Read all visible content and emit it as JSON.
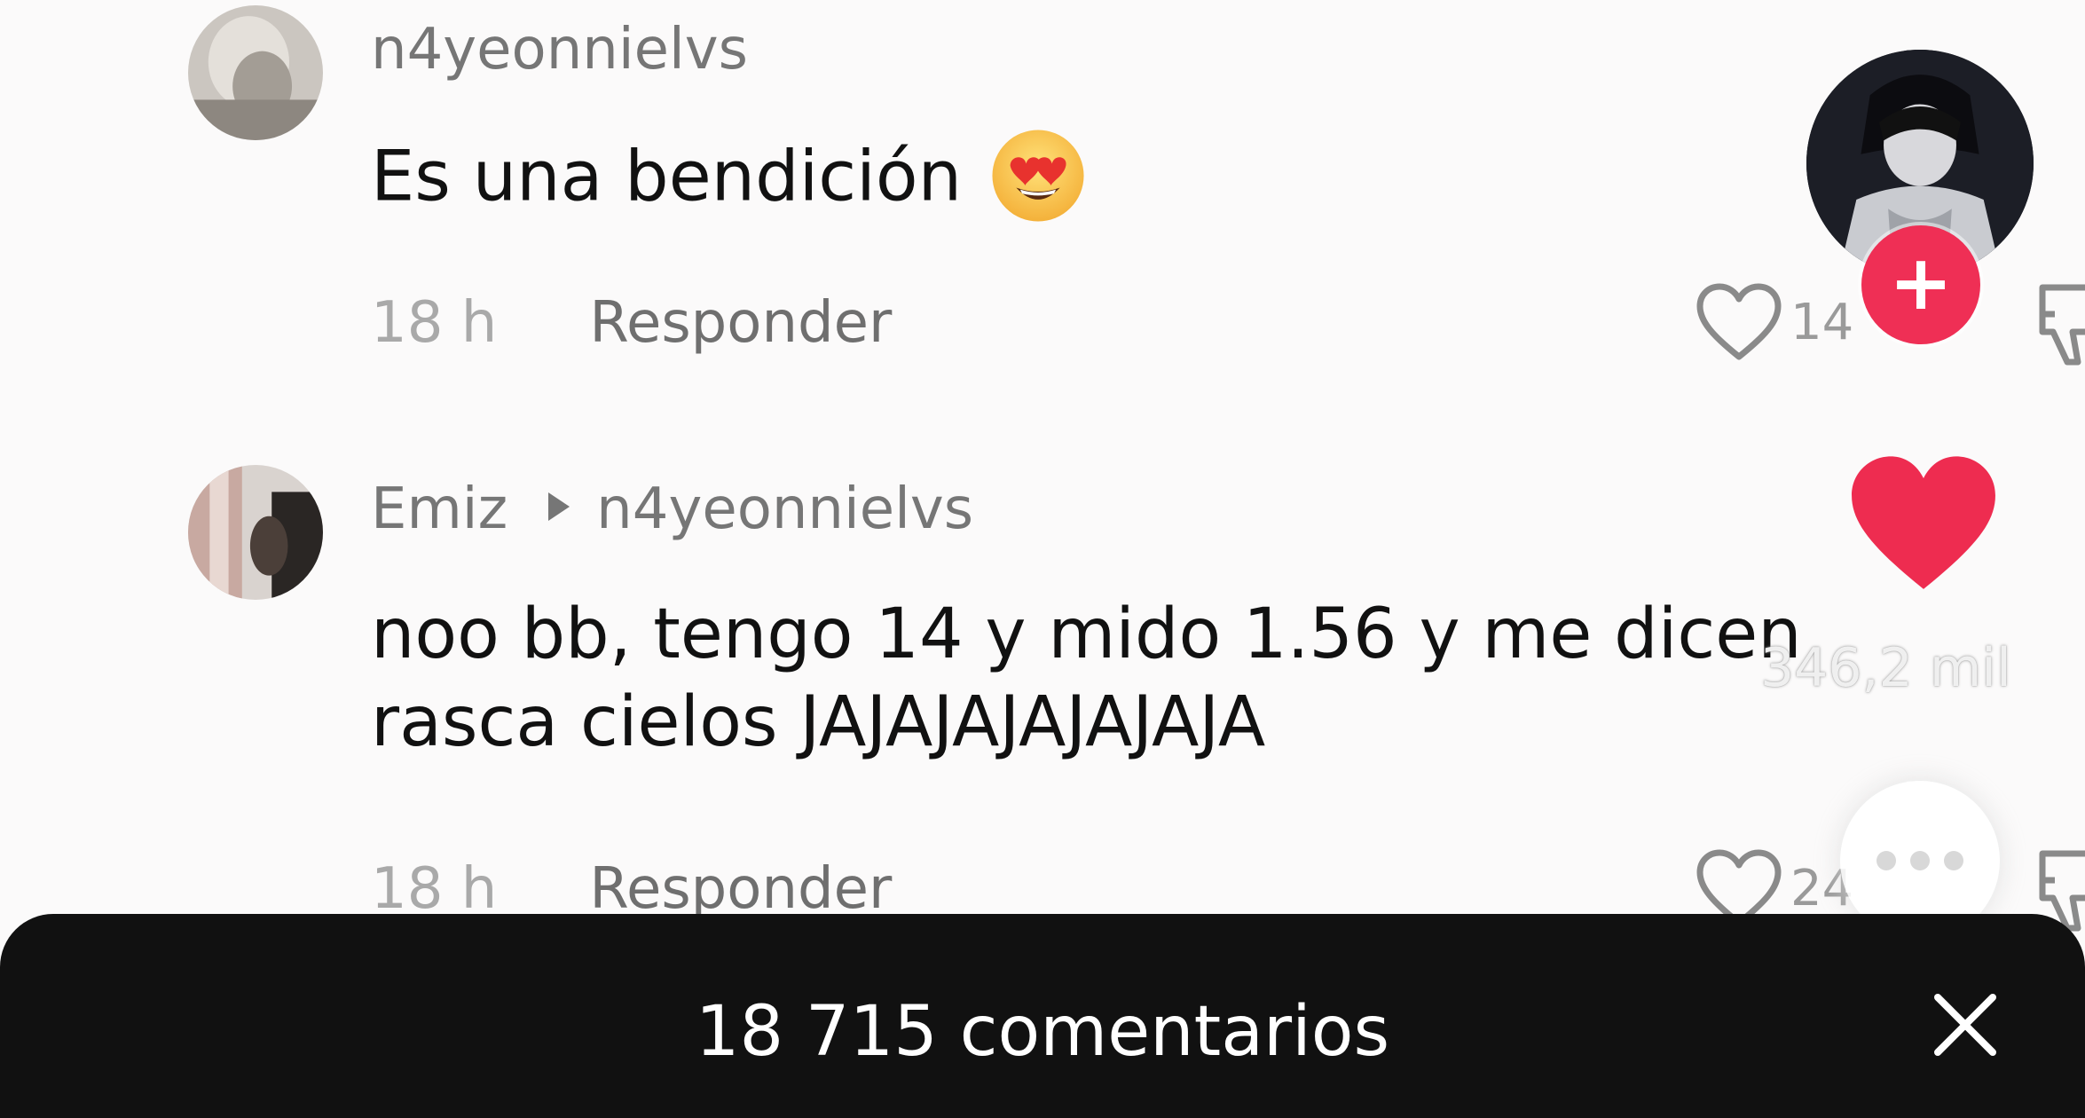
{
  "comments": [
    {
      "username": "n4yeonnielvs",
      "text": "Es una bendición",
      "emoji": "heart-eyes-emoji",
      "time": "18 h",
      "reply_label": "Responder",
      "likes": "14"
    },
    {
      "username": "Emiz",
      "reply_to": "n4yeonnielvs",
      "text_line1": "noo bb, tengo 14 y mido 1.56 y me dicen",
      "text_line2": "rasca cielos JAJAJAJAJAJAJA",
      "time": "18 h",
      "reply_label": "Responder",
      "likes": "24"
    }
  ],
  "video_overlay": {
    "likes_count": "346,2 mil",
    "follow_symbol": "+"
  },
  "footer": {
    "comment_count": "18 715 comentarios"
  },
  "colors": {
    "background": "#fbfafa",
    "accent_red": "#ef2f55",
    "footer_bg": "#111111"
  }
}
